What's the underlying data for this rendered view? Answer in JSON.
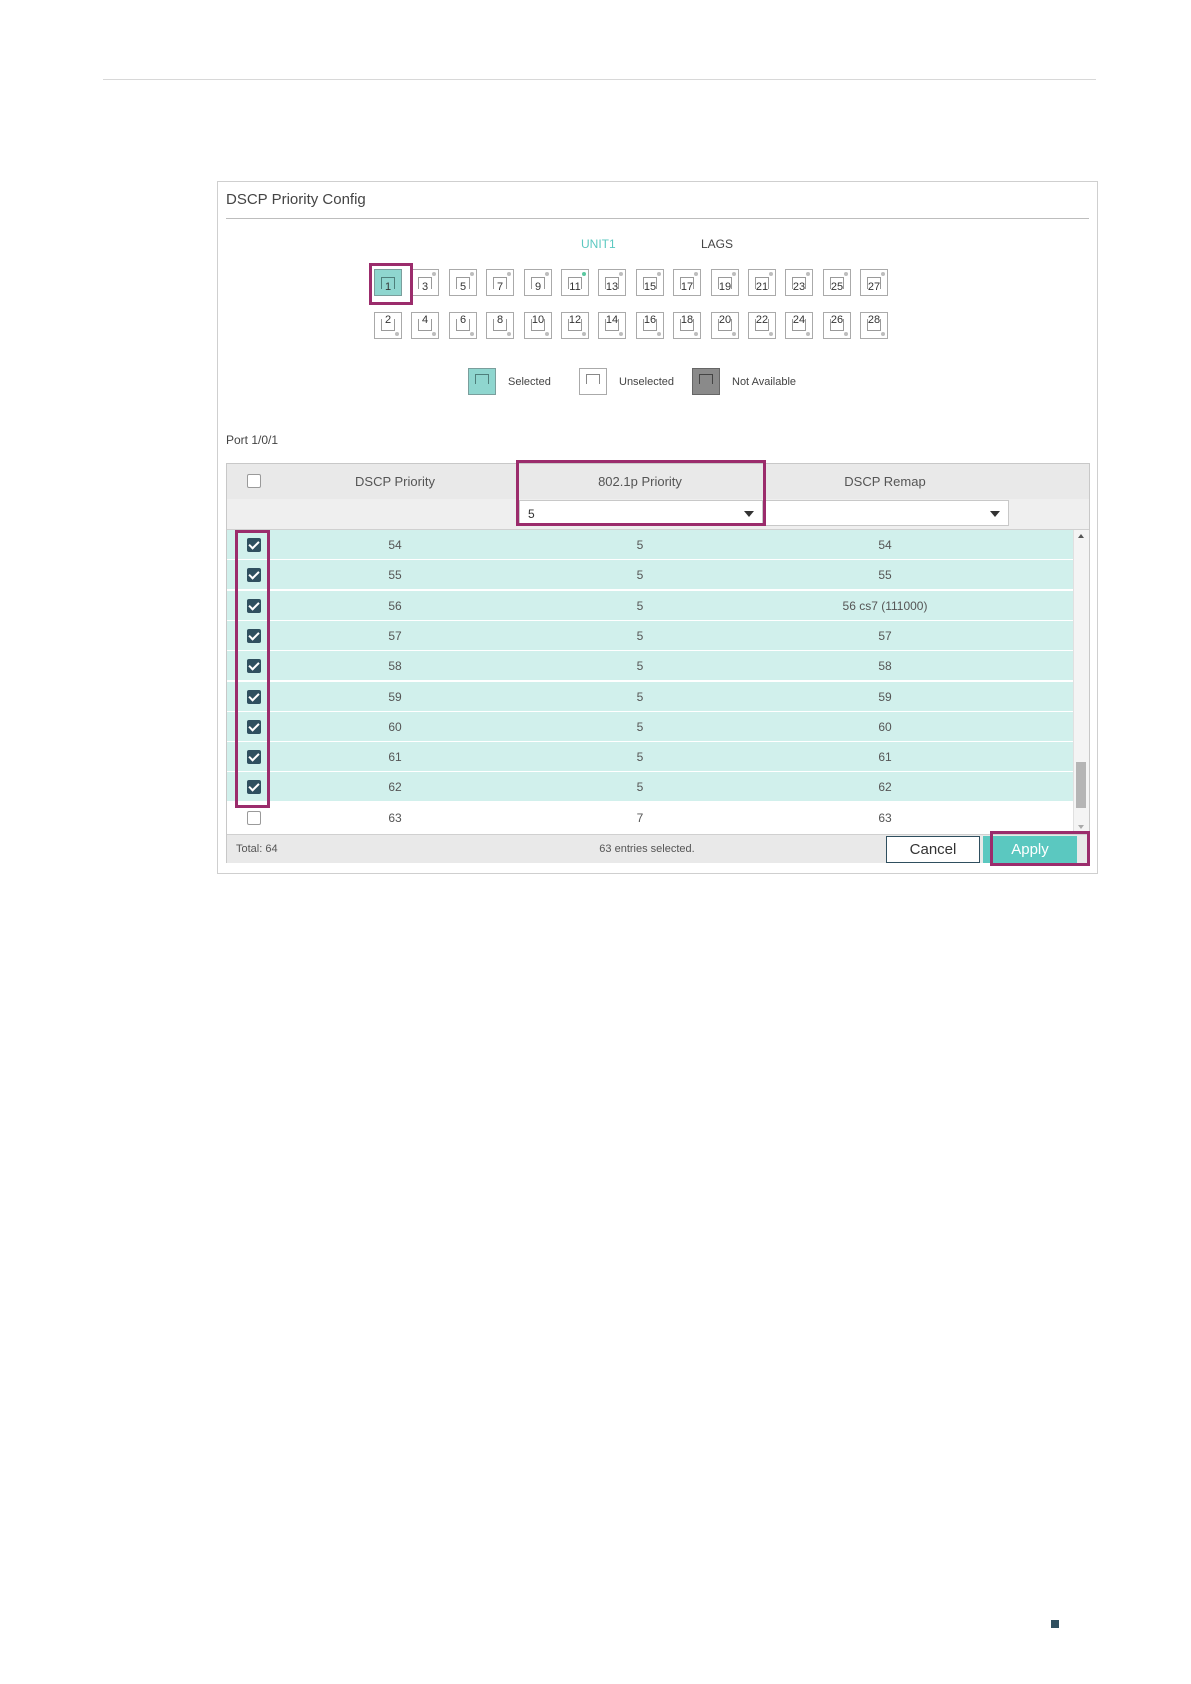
{
  "panel": {
    "title": "DSCP Priority Config"
  },
  "tabs": {
    "unit": "UNIT1",
    "lags": "LAGS"
  },
  "ports": {
    "top": [
      {
        "num": "1",
        "state": "selected"
      },
      {
        "num": "3",
        "state": "unselected"
      },
      {
        "num": "5",
        "state": "unselected"
      },
      {
        "num": "7",
        "state": "unselected"
      },
      {
        "num": "9",
        "state": "unselected"
      },
      {
        "num": "11",
        "state": "unselected",
        "link": true
      },
      {
        "num": "13",
        "state": "unselected"
      },
      {
        "num": "15",
        "state": "unselected"
      },
      {
        "num": "17",
        "state": "unselected"
      },
      {
        "num": "19",
        "state": "unselected"
      },
      {
        "num": "21",
        "state": "unselected"
      },
      {
        "num": "23",
        "state": "unselected"
      },
      {
        "num": "25",
        "state": "unselected"
      },
      {
        "num": "27",
        "state": "unselected"
      }
    ],
    "bottom": [
      {
        "num": "2",
        "state": "unselected"
      },
      {
        "num": "4",
        "state": "unselected"
      },
      {
        "num": "6",
        "state": "unselected"
      },
      {
        "num": "8",
        "state": "unselected"
      },
      {
        "num": "10",
        "state": "unselected"
      },
      {
        "num": "12",
        "state": "unselected"
      },
      {
        "num": "14",
        "state": "unselected"
      },
      {
        "num": "16",
        "state": "unselected"
      },
      {
        "num": "18",
        "state": "unselected"
      },
      {
        "num": "20",
        "state": "unselected"
      },
      {
        "num": "22",
        "state": "unselected"
      },
      {
        "num": "24",
        "state": "unselected"
      },
      {
        "num": "26",
        "state": "unselected"
      },
      {
        "num": "28",
        "state": "unselected"
      }
    ]
  },
  "legend": {
    "selected": "Selected",
    "unselected": "Unselected",
    "not_available": "Not Available"
  },
  "port_label": "Port 1/0/1",
  "table": {
    "headers": {
      "dscp_priority": "DSCP Priority",
      "dot1p_priority": "802.1p Priority",
      "dscp_remap": "DSCP Remap"
    },
    "filter": {
      "dot1p_value": "5",
      "remap_value": ""
    },
    "rows": [
      {
        "checked": true,
        "dscp": "54",
        "dot1p": "5",
        "remap": "54"
      },
      {
        "checked": true,
        "dscp": "55",
        "dot1p": "5",
        "remap": "55"
      },
      {
        "checked": true,
        "dscp": "56",
        "dot1p": "5",
        "remap": "56 cs7 (111000)"
      },
      {
        "checked": true,
        "dscp": "57",
        "dot1p": "5",
        "remap": "57"
      },
      {
        "checked": true,
        "dscp": "58",
        "dot1p": "5",
        "remap": "58"
      },
      {
        "checked": true,
        "dscp": "59",
        "dot1p": "5",
        "remap": "59"
      },
      {
        "checked": true,
        "dscp": "60",
        "dot1p": "5",
        "remap": "60"
      },
      {
        "checked": true,
        "dscp": "61",
        "dot1p": "5",
        "remap": "61"
      },
      {
        "checked": true,
        "dscp": "62",
        "dot1p": "5",
        "remap": "62"
      },
      {
        "checked": false,
        "dscp": "63",
        "dot1p": "7",
        "remap": "63"
      }
    ],
    "footer": {
      "total": "Total: 64",
      "selected_count": "63 entries selected."
    },
    "buttons": {
      "cancel": "Cancel",
      "apply": "Apply"
    }
  },
  "colors": {
    "accent": "#5bc8c0",
    "selected_row": "#d1f0ec",
    "highlight": "#9b2c6c",
    "checkbox": "#2f4f5f"
  }
}
